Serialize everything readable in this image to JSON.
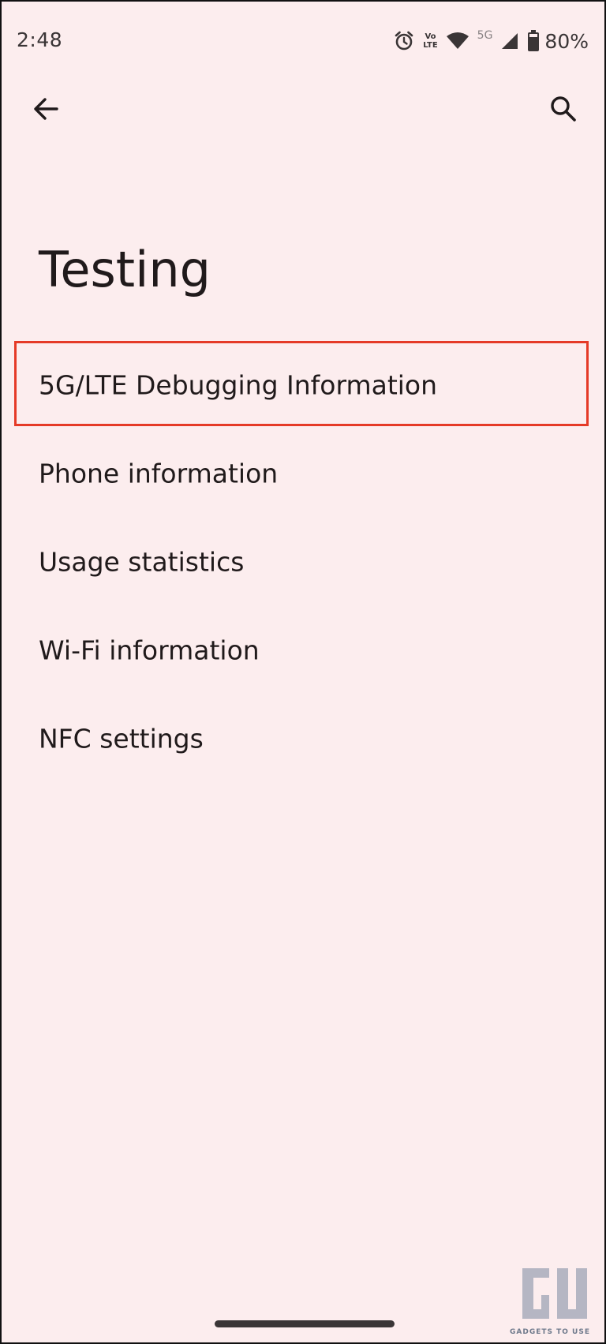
{
  "status_bar": {
    "time": "2:48",
    "volte_top": "Vo",
    "volte_bottom": "LTE",
    "network": "5G",
    "battery": "80%",
    "icons": [
      "alarm-icon",
      "volte-icon",
      "wifi-icon",
      "cellular-signal-icon",
      "battery-icon"
    ]
  },
  "app_bar": {
    "back_icon": "arrow-back-icon",
    "search_icon": "search-icon"
  },
  "page": {
    "title": "Testing"
  },
  "items": [
    {
      "label": "5G/LTE Debugging Information",
      "highlighted": true
    },
    {
      "label": "Phone information",
      "highlighted": false
    },
    {
      "label": "Usage statistics",
      "highlighted": false
    },
    {
      "label": "Wi-Fi information",
      "highlighted": false
    },
    {
      "label": "NFC settings",
      "highlighted": false
    }
  ],
  "watermark": {
    "text": "GADGETS TO USE"
  },
  "colors": {
    "background": "#fcedee",
    "text": "#201a1b",
    "highlight": "#e53a27"
  }
}
